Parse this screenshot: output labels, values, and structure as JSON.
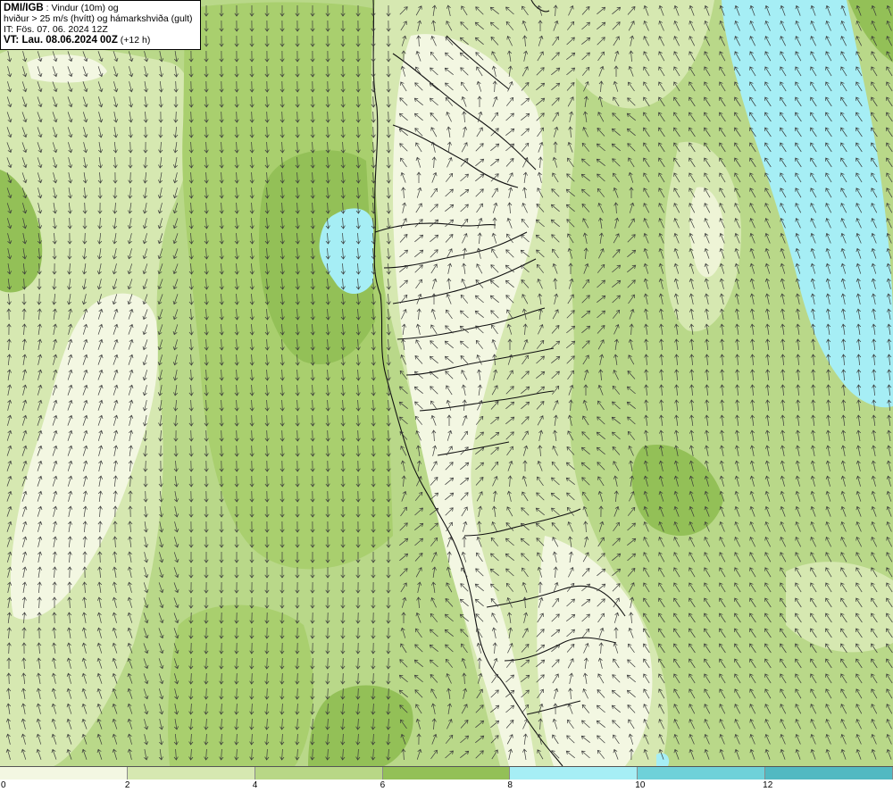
{
  "header": {
    "source": "DMI/IGB",
    "title_rest": ": Vindur (10m) og",
    "line2": "hviður > 25 m/s (hvítt) og hámarkshviða (gult)",
    "init_time": "IT: Fös. 07. 06. 2024 12Z",
    "valid_label": "VT: Lau. 08.06.2024 00Z",
    "valid_offset": "(+12 h)"
  },
  "legend": {
    "ticks": [
      "0",
      "2",
      "4",
      "6",
      "8",
      "10",
      "12"
    ],
    "colors": [
      "#f3f7e2",
      "#d6e8b1",
      "#b8d786",
      "#93c057",
      "#a6eef5",
      "#6fd1d9",
      "#52b9c2"
    ]
  },
  "map_colors": {
    "calm": "#f3f7e2",
    "light": "#d6e8b1",
    "moderate": "#b9d889",
    "fresh": "#93c057",
    "strong": "#a6eef5",
    "coast_line": "#111111",
    "arrow": "#3a3a3a"
  },
  "icons": [
    "wind-arrow-icon"
  ]
}
